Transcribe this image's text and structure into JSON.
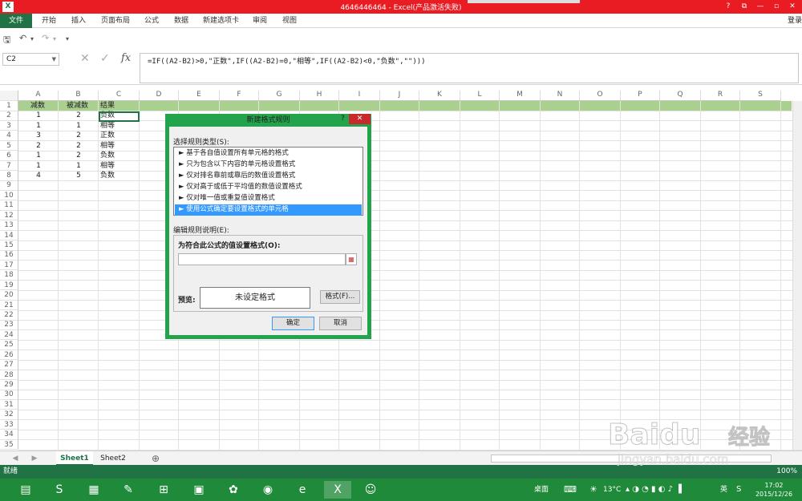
{
  "window": {
    "title": "4646446464 - Excel(产品激活失败)",
    "app_icon": "X",
    "help": "?",
    "min": "—",
    "max": "▫",
    "close": "✕",
    "restore": "⧉"
  },
  "ribbon": {
    "file": "文件",
    "tabs": [
      "开始",
      "插入",
      "页面布局",
      "公式",
      "数据",
      "新建选项卡",
      "审阅",
      "视图"
    ],
    "login": "登录"
  },
  "qat": {
    "save": "🖫",
    "undo": "↶",
    "undo_dd": "▾",
    "redo": "↷",
    "redo_dd": "▾",
    "customize": "▾"
  },
  "formula_bar": {
    "name_box": "C2",
    "cancel": "✕",
    "enter": "✓",
    "fx": "fx",
    "formula": "=IF((A2-B2)>0,\"正数\",IF((A2-B2)=0,\"相等\",IF((A2-B2)<0,\"负数\",\"\")))"
  },
  "grid": {
    "columns": [
      "A",
      "B",
      "C",
      "D",
      "E",
      "F",
      "G",
      "H",
      "I",
      "J",
      "K",
      "L",
      "M",
      "N",
      "O",
      "P",
      "Q",
      "R",
      "S"
    ],
    "rows": [
      "1",
      "2",
      "3",
      "4",
      "5",
      "6",
      "7",
      "8",
      "9",
      "10",
      "11",
      "12",
      "13",
      "14",
      "15",
      "16",
      "17",
      "18",
      "19",
      "20",
      "21",
      "22",
      "23",
      "24",
      "25",
      "26",
      "27",
      "28",
      "29",
      "30",
      "31",
      "32",
      "33",
      "34",
      "35"
    ],
    "header": {
      "a": "减数",
      "b": "被减数",
      "c": "结果"
    },
    "data": [
      {
        "a": "1",
        "b": "2",
        "c": "负数"
      },
      {
        "a": "1",
        "b": "1",
        "c": "相等"
      },
      {
        "a": "3",
        "b": "2",
        "c": "正数"
      },
      {
        "a": "2",
        "b": "2",
        "c": "相等"
      },
      {
        "a": "1",
        "b": "2",
        "c": "负数"
      },
      {
        "a": "1",
        "b": "1",
        "c": "相等"
      },
      {
        "a": "4",
        "b": "5",
        "c": "负数"
      }
    ],
    "highlight_color": "#a9d08e"
  },
  "sheets": {
    "tabs": [
      "Sheet1",
      "Sheet2"
    ],
    "active": "Sheet1",
    "add": "⊕",
    "prev": "◀",
    "next": "▶"
  },
  "status": {
    "ready": "就绪",
    "zoom": "100%"
  },
  "dialog": {
    "title": "新建格式规则",
    "help": "?",
    "close": "✕",
    "select_type_label": "选择规则类型(S):",
    "rule_types": [
      "► 基于各自值设置所有单元格的格式",
      "► 只为包含以下内容的单元格设置格式",
      "► 仅对排名靠前或靠后的数值设置格式",
      "► 仅对高于或低于平均值的数值设置格式",
      "► 仅对唯一值或重复值设置格式",
      "► 使用公式确定要设置格式的单元格"
    ],
    "selected_rule_index": 5,
    "edit_desc_label": "编辑规则说明(E):",
    "formula_label": "为符合此公式的值设置格式(O):",
    "formula_value": "",
    "preview_label": "预览:",
    "preview_text": "未设定格式",
    "format_button": "格式(F)...",
    "ok_button": "确定",
    "cancel_button": "取消"
  },
  "taskbar": {
    "desktop_label": "桌面",
    "temperature": "13°C",
    "ime": "英",
    "time": "17:02",
    "date": "2015/12/26"
  },
  "watermark": {
    "brand": "Baidu",
    "cn": "经验",
    "url": "jingyan.baidu.com"
  },
  "colors": {
    "excel_green": "#217346",
    "titlebar_red": "#e91c24",
    "taskbar_green": "#1f8a3a",
    "dialog_border": "#23a34b",
    "selection_blue": "#3399ff"
  }
}
